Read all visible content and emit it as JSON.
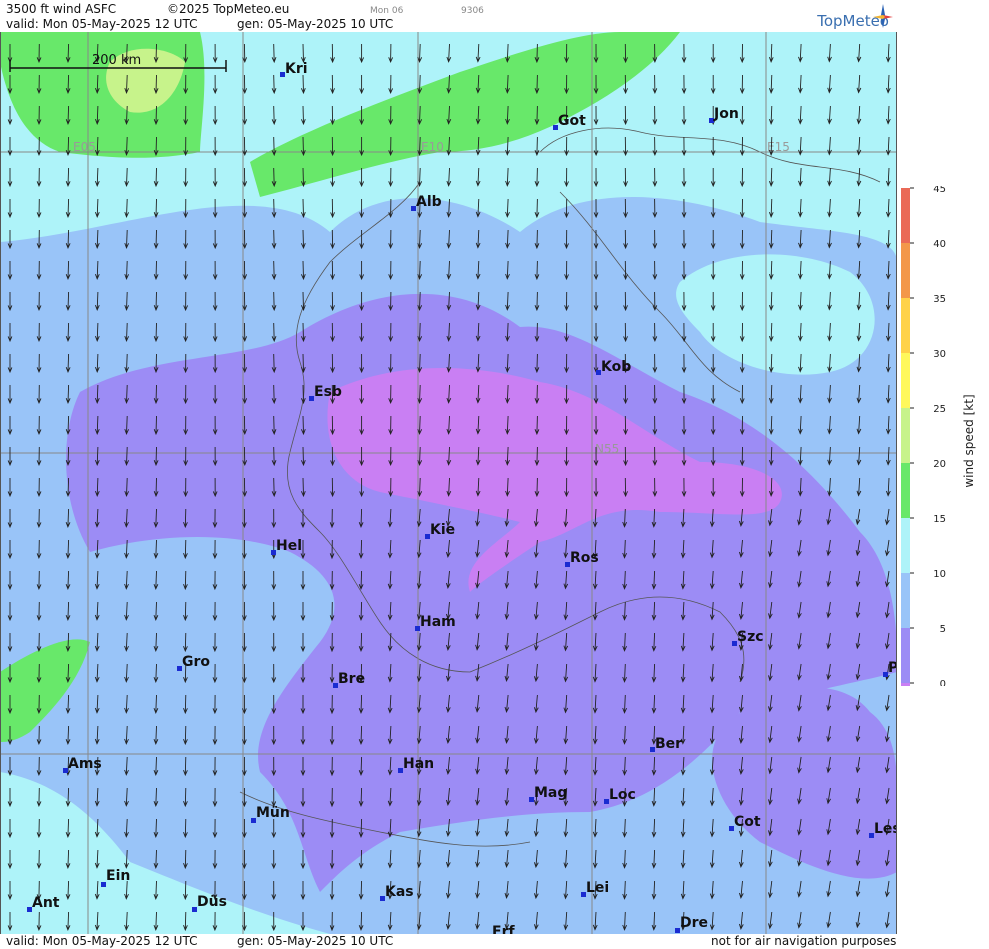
{
  "header": {
    "product": "3500 ft wind ASFC",
    "copyright": "©2025 TopMeteo.eu",
    "day_code": "Mon 06",
    "small_code": "9306",
    "valid": "valid:  Mon  05-May-2025  12 UTC",
    "generated": "gen: 05-May-2025 10 UTC",
    "logo": "TopMeteo"
  },
  "footer": {
    "valid": "valid:  Mon  05-May-2025  12 UTC",
    "generated": "gen: 05-May-2025 10 UTC",
    "disclaimer": "not for air navigation purposes"
  },
  "map": {
    "scale_bar": "200 km",
    "grid_labels": [
      "E05",
      "E10",
      "E15",
      "N55"
    ],
    "cities": [
      "Kri",
      "Got",
      "Jon",
      "Alb",
      "Kob",
      "Esb",
      "Kie",
      "Ros",
      "Hel",
      "Ham",
      "Szc",
      "Gro",
      "Bre",
      "P",
      "Ber",
      "Ams",
      "Han",
      "Mag",
      "Loc",
      "Cot",
      "Les",
      "Mün",
      "Ein",
      "Kas",
      "Lei",
      "Ant",
      "Düs",
      "Dre",
      "Erf"
    ],
    "wind_flow": "north",
    "colors": {
      "calm": "#c97ff3",
      "light": "#9c8cf5",
      "moderate": "#99c4f8",
      "fresh": "#aef3f9",
      "strong": "#68e86a",
      "very_strong": "#c7f38b"
    }
  },
  "legend": {
    "title": "wind speed [kt]",
    "ticks": [
      "45",
      "40",
      "35",
      "30",
      "25",
      "20",
      "15",
      "10",
      "5",
      "0"
    ],
    "colors": [
      "#ea6a57",
      "#f3974a",
      "#ffd24a",
      "#fff85b",
      "#c7f38b",
      "#68e86a",
      "#aef3f9",
      "#99c4f8",
      "#9c8cf5",
      "#c97ff3"
    ]
  }
}
